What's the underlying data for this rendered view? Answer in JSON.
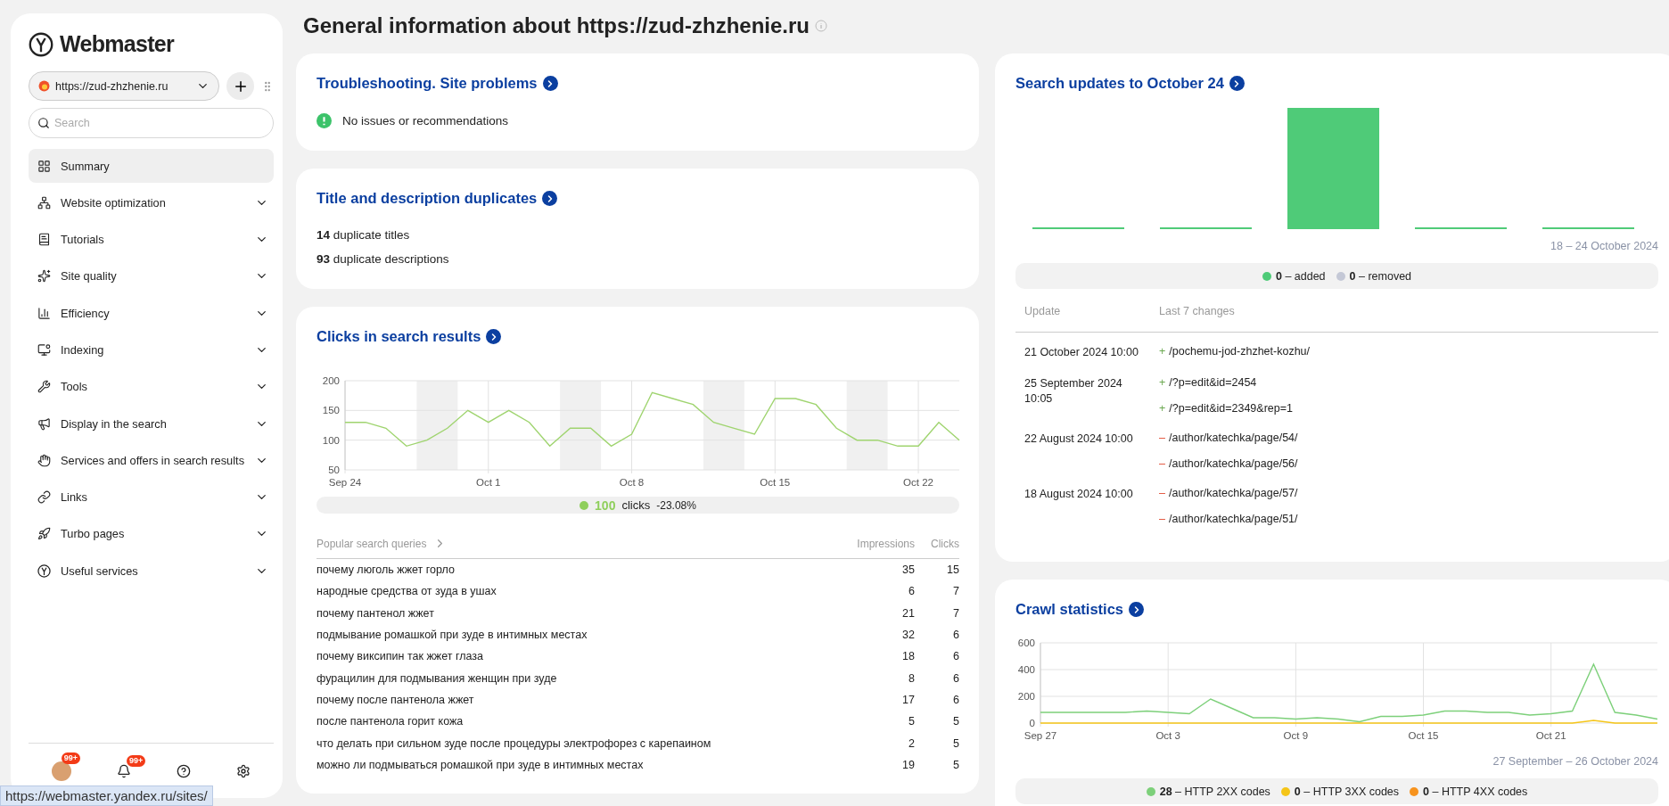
{
  "sidebar": {
    "logo": "Webmaster",
    "site": "https://zud-zhzhenie.ru",
    "search": {
      "placeholder": "Search"
    },
    "items": [
      {
        "label": "Summary",
        "kind": "link",
        "selected": true
      },
      {
        "label": "Website optimization",
        "kind": "group",
        "selected": false
      },
      {
        "label": "Tutorials",
        "kind": "group",
        "selected": false
      },
      {
        "label": "Site quality",
        "kind": "group",
        "selected": false
      },
      {
        "label": "Efficiency",
        "kind": "group",
        "selected": false
      },
      {
        "label": "Indexing",
        "kind": "group",
        "selected": false
      },
      {
        "label": "Tools",
        "kind": "group",
        "selected": false
      },
      {
        "label": "Display in the search",
        "kind": "group",
        "selected": false
      },
      {
        "label": "Services and offers in search results",
        "kind": "group",
        "selected": false
      },
      {
        "label": "Links",
        "kind": "group",
        "selected": false
      },
      {
        "label": "Turbo pages",
        "kind": "group",
        "selected": false
      },
      {
        "label": "Useful services",
        "kind": "group",
        "selected": false
      }
    ],
    "footer": {
      "avatar_badge": "99+",
      "bell_badge": "99+"
    }
  },
  "title": "General information about https://zud-zhzhenie.ru",
  "troubleshooting": {
    "title": "Troubleshooting. Site problems",
    "message": "No issues or recommendations"
  },
  "duplicates": {
    "title": "Title and description duplicates",
    "lines": [
      {
        "count": "14",
        "text": "duplicate titles"
      },
      {
        "count": "93",
        "text": "duplicate descriptions"
      }
    ]
  },
  "clicks": {
    "title": "Clicks in search results",
    "chart_data": {
      "type": "line",
      "x": [
        "Sep 24",
        null,
        null,
        null,
        null,
        null,
        null,
        "Oct 1",
        null,
        null,
        null,
        null,
        null,
        null,
        "Oct 8",
        null,
        null,
        null,
        null,
        null,
        null,
        "Oct 15",
        null,
        null,
        null,
        null,
        null,
        null,
        "Oct 22",
        null,
        null
      ],
      "series": [
        {
          "name": "clicks",
          "color": "#9fd46f",
          "values": [
            130,
            130,
            120,
            90,
            100,
            120,
            150,
            130,
            150,
            130,
            90,
            120,
            120,
            90,
            110,
            180,
            170,
            160,
            130,
            120,
            110,
            170,
            170,
            160,
            120,
            100,
            100,
            90,
            90,
            130,
            100
          ]
        }
      ],
      "ylim": [
        50,
        200
      ],
      "yticks": [
        50,
        100,
        150,
        200
      ],
      "grid": true
    },
    "legend": {
      "value": "100",
      "change": "-23.08%",
      "color": "#8fcf5c"
    },
    "queries": {
      "title": "Popular search queries",
      "columns": [
        "Impressions",
        "Clicks"
      ],
      "rows": [
        {
          "query": "почему люголь жжет горло",
          "impressions": "35",
          "clicks": "15"
        },
        {
          "query": "народные средства от зуда в ушах",
          "impressions": "6",
          "clicks": "7"
        },
        {
          "query": "почему пантенол жжет",
          "impressions": "21",
          "clicks": "7"
        },
        {
          "query": "подмывание ромашкой при зуде в интимных местах",
          "impressions": "32",
          "clicks": "6"
        },
        {
          "query": "почему виксипин так жжет глаза",
          "impressions": "18",
          "clicks": "6"
        },
        {
          "query": "фурацилин для подмывания женщин при зуде",
          "impressions": "8",
          "clicks": "6"
        },
        {
          "query": "почему после пантенола жжет",
          "impressions": "17",
          "clicks": "6"
        },
        {
          "query": "после пантенола горит кожа",
          "impressions": "5",
          "clicks": "5"
        },
        {
          "query": "что делать при сильном зуде после процедуры электрофорез с карепаином",
          "impressions": "2",
          "clicks": "5"
        },
        {
          "query": "можно ли подмываться ромашкой при зуде в интимных местах",
          "impressions": "19",
          "clicks": "5"
        }
      ]
    }
  },
  "updates": {
    "title": "Search updates to October 24",
    "period": "18 – 24 October 2024",
    "legend": [
      {
        "count": "0",
        "label": "– added",
        "color": "#4fcb78"
      },
      {
        "count": "0",
        "label": "– removed",
        "color": "#c4c8d6"
      }
    ],
    "columns": [
      "Update",
      "Last 7 changes"
    ],
    "rows": [
      {
        "date": "21 October 2024 10:00",
        "changes": [
          {
            "kind": "added",
            "sign": "+",
            "path": "/pochemu-jod-zhzhet-kozhu/"
          }
        ]
      },
      {
        "date": "25 September 2024 10:05",
        "changes": [
          {
            "kind": "added",
            "sign": "+",
            "path": "/?p=edit&id=2454"
          },
          {
            "kind": "added",
            "sign": "+",
            "path": "/?p=edit&id=2349&rep=1"
          }
        ]
      },
      {
        "date": "22 August 2024 10:00",
        "changes": [
          {
            "kind": "removed",
            "sign": "–",
            "path": "/author/katechka/page/54/"
          },
          {
            "kind": "removed",
            "sign": "–",
            "path": "/author/katechka/page/56/"
          }
        ]
      },
      {
        "date": "18 August 2024 10:00",
        "changes": [
          {
            "kind": "removed",
            "sign": "–",
            "path": "/author/katechka/page/57/"
          },
          {
            "kind": "removed",
            "sign": "–",
            "path": "/author/katechka/page/51/"
          }
        ]
      }
    ]
  },
  "crawl": {
    "title": "Crawl statistics",
    "period": "27 September – 26 October 2024",
    "chart_data": {
      "type": "line",
      "x": [
        "Sep 27",
        null,
        null,
        null,
        null,
        null,
        "Oct 3",
        null,
        null,
        null,
        null,
        null,
        "Oct 9",
        null,
        null,
        null,
        null,
        null,
        "Oct 15",
        null,
        null,
        null,
        null,
        null,
        "Oct 21",
        null,
        null,
        null,
        null,
        null
      ],
      "series": [
        {
          "name": "HTTP 2XX codes",
          "color": "#7dd07a",
          "values": [
            80,
            80,
            80,
            80,
            80,
            90,
            80,
            70,
            180,
            110,
            40,
            40,
            30,
            40,
            30,
            10,
            50,
            50,
            60,
            90,
            90,
            80,
            80,
            60,
            70,
            90,
            440,
            80,
            60,
            30
          ]
        },
        {
          "name": "HTTP 3XX codes",
          "color": "#f5c518",
          "values": [
            0,
            0,
            0,
            0,
            0,
            0,
            0,
            0,
            0,
            0,
            0,
            0,
            0,
            0,
            0,
            0,
            0,
            0,
            0,
            0,
            0,
            0,
            0,
            0,
            0,
            0,
            20,
            0,
            0,
            0
          ]
        }
      ],
      "ylim": [
        0,
        600
      ],
      "yticks": [
        0,
        200,
        400,
        600
      ],
      "grid": true
    },
    "legend": [
      {
        "count": "28",
        "sep": "–",
        "color": "#7dd07a"
      },
      {
        "count": "0",
        "sep": "–",
        "color": "#f5c518"
      },
      {
        "count": "0",
        "sep": "–",
        "label": "HTTP 4XX codes",
        "color": "#f7931e"
      }
    ]
  },
  "status_url": "https://webmaster.yandex.ru/sites/"
}
